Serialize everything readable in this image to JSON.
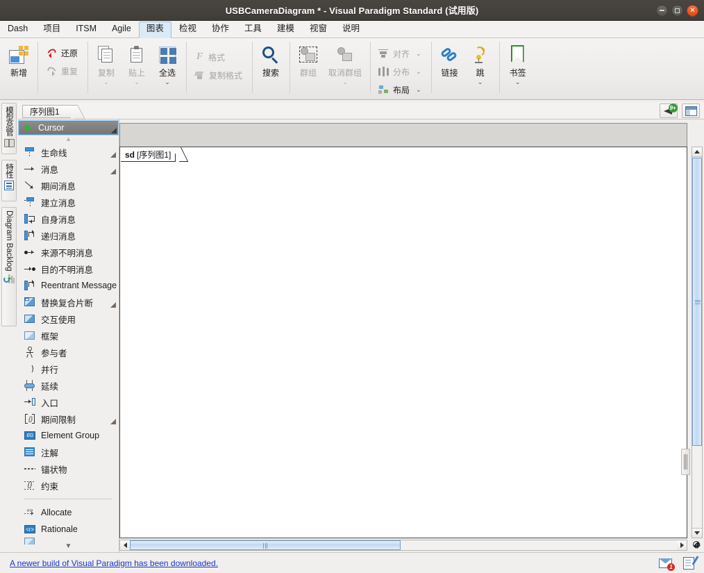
{
  "window": {
    "title": "USBCameraDiagram * - Visual Paradigm Standard (试用版)",
    "controls": {
      "minimize": "minimize-button",
      "maximize": "maximize-button",
      "close": "close-button"
    }
  },
  "menubar": {
    "items": [
      {
        "label": "Dash",
        "active": false
      },
      {
        "label": "项目",
        "active": false
      },
      {
        "label": "ITSM",
        "active": false
      },
      {
        "label": "Agile",
        "active": false
      },
      {
        "label": "图表",
        "active": true
      },
      {
        "label": "检视",
        "active": false
      },
      {
        "label": "协作",
        "active": false
      },
      {
        "label": "工具",
        "active": false
      },
      {
        "label": "建模",
        "active": false
      },
      {
        "label": "视窗",
        "active": false
      },
      {
        "label": "说明",
        "active": false
      }
    ]
  },
  "ribbon": {
    "new_label": "新增",
    "undo_label": "还原",
    "redo_label": "重复",
    "copy_label": "复制",
    "paste_label": "贴上",
    "select_all_label": "全选",
    "format_label": "格式",
    "copy_format_label": "复制格式",
    "search_label": "搜索",
    "group_label": "群组",
    "ungroup_label": "取消群组",
    "align_label": "对齐",
    "distribute_label": "分布",
    "layout_label": "布局",
    "link_label": "链接",
    "jump_label": "跳",
    "bookmark_label": "书签",
    "caret": "⌄"
  },
  "rail": {
    "tabs": [
      {
        "label": "模型总管",
        "icon": "model-explorer-icon",
        "latin": false
      },
      {
        "label": "特性",
        "icon": "properties-icon",
        "latin": false
      },
      {
        "label": "Diagram Backlog",
        "icon": "backlog-icon",
        "latin": true
      }
    ]
  },
  "tabstrip": {
    "diagram_tab": "序列图1",
    "announce_badge": "9+",
    "icons": [
      "megaphone-icon",
      "panel-layout-icon"
    ]
  },
  "palette": {
    "selected": {
      "label": "Cursor",
      "icon": "cursor-icon"
    },
    "scroll_up": "▲",
    "scroll_down": "▼",
    "items": [
      {
        "label": "生命线",
        "icon": "lifeline-icon",
        "expandable": true
      },
      {
        "label": "消息",
        "icon": "message-icon",
        "expandable": true
      },
      {
        "label": "期间消息",
        "icon": "duration-message-icon",
        "expandable": false
      },
      {
        "label": "建立消息",
        "icon": "create-message-icon",
        "expandable": false
      },
      {
        "label": "自身消息",
        "icon": "self-message-icon",
        "expandable": false
      },
      {
        "label": "递归消息",
        "icon": "recursive-message-icon",
        "expandable": false
      },
      {
        "label": "来源不明消息",
        "icon": "found-message-icon",
        "expandable": false
      },
      {
        "label": "目的不明消息",
        "icon": "lost-message-icon",
        "expandable": false
      },
      {
        "label": "Reentrant Message",
        "icon": "reentrant-message-icon",
        "expandable": false
      },
      {
        "label": "替换复合片断",
        "icon": "combined-fragment-icon",
        "expandable": true
      },
      {
        "label": "交互使用",
        "icon": "interaction-use-icon",
        "expandable": false
      },
      {
        "label": "框架",
        "icon": "frame-icon",
        "expandable": false
      },
      {
        "label": "参与者",
        "icon": "actor-icon",
        "expandable": false
      },
      {
        "label": "并行",
        "icon": "parallel-icon",
        "expandable": false
      },
      {
        "label": "延续",
        "icon": "continuation-icon",
        "expandable": false
      },
      {
        "label": "入口",
        "icon": "gate-icon",
        "expandable": false
      },
      {
        "label": "期间限制",
        "icon": "duration-constraint-icon",
        "expandable": true
      },
      {
        "label": "Element Group",
        "icon": "element-group-icon",
        "expandable": false
      },
      {
        "label": "注解",
        "icon": "note-icon",
        "expandable": false
      },
      {
        "label": "锚状物",
        "icon": "anchor-icon",
        "expandable": false
      },
      {
        "label": "约束",
        "icon": "constraint-icon",
        "expandable": false
      },
      {
        "label": "__divider__",
        "icon": "",
        "expandable": false
      },
      {
        "label": "Allocate",
        "icon": "allocate-icon",
        "expandable": false
      },
      {
        "label": "Rationale",
        "icon": "rationale-icon",
        "expandable": false
      },
      {
        "label": "",
        "icon": "partial-icon",
        "expandable": false
      }
    ]
  },
  "canvas": {
    "frame_kind": "sd",
    "frame_name": "[序列图1]"
  },
  "statusbar": {
    "message": "A newer build of Visual Paradigm has been downloaded.",
    "mail_badge": "1",
    "icons": [
      "mail-icon",
      "note-icon"
    ]
  },
  "colors": {
    "titlebar": "#403d39",
    "accent_blue": "#4a90d9",
    "link": "#1a35c8",
    "selection": "#767676",
    "badge_green": "#3a9b3a",
    "badge_red": "#d62b1f"
  }
}
